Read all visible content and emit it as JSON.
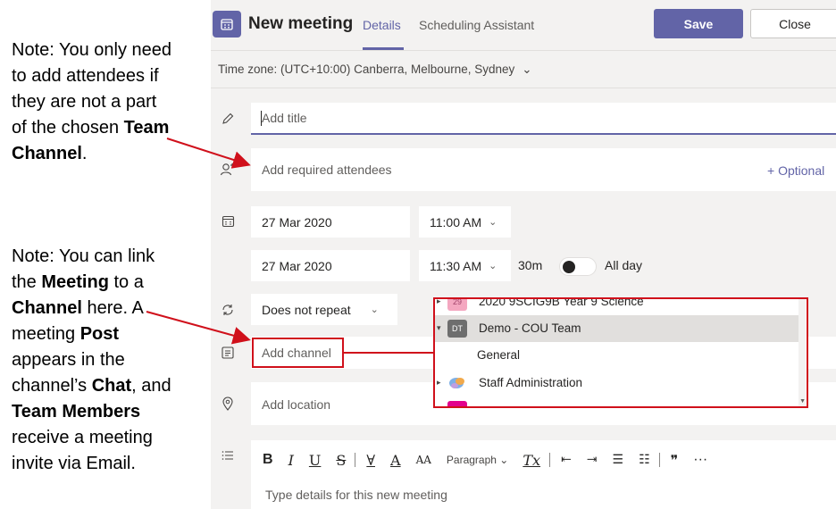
{
  "annotations": {
    "note1": {
      "p1": "Note: You only need to add attendees if they are not a part of the chosen ",
      "b1": "Team Channel",
      "p2": "."
    },
    "note2": {
      "p1": "Note: You can link the ",
      "b1": "Meeting",
      "p2": " to a ",
      "b2": "Channel",
      "p3": " here. A meeting ",
      "b3": "Post",
      "p4": " appears in the channel’s ",
      "b4": "Chat",
      "p5": ", and ",
      "b5": "Team Members",
      "p6": " receive a meeting invite via Email."
    },
    "highlight_color": "#d0101b"
  },
  "header": {
    "title": "New meeting",
    "tabs": [
      "Details",
      "Scheduling Assistant"
    ],
    "save_label": "Save",
    "close_label": "Close",
    "accent": "#6264a7"
  },
  "timezone": {
    "label": "Time zone: (UTC+10:00) Canberra, Melbourne, Sydney",
    "chevron": "⌄"
  },
  "form": {
    "title_placeholder": "Add title",
    "attendees_placeholder": "Add required attendees",
    "optional_label": "+ Optional",
    "start_date": "27 Mar 2020",
    "start_time": "11:00 AM",
    "end_date": "27 Mar 2020",
    "end_time": "11:30 AM",
    "duration": "30m",
    "all_day_label": "All day",
    "all_day_on": false,
    "repeat": "Does not repeat",
    "channel_placeholder": "Add channel",
    "location_placeholder": "Add location",
    "details_placeholder": "Type details for this new meeting",
    "chevron": "⌄"
  },
  "toolbar": {
    "bold": "B",
    "italic": "I",
    "underline": "U",
    "strike": "S",
    "highlight": "∀",
    "font_color": "A",
    "font_size": "AA",
    "paragraph": "Paragraph ⌄",
    "clear_format": "Tx",
    "outdent": "⇤",
    "indent": "⇥",
    "bullets": "☰",
    "numbered": "☷",
    "quote": "❞",
    "more": "···"
  },
  "channel_dropdown": {
    "items": [
      {
        "label": "2020 9SCIG9B Year 9 Science",
        "arrow": "▸",
        "avatar": "29",
        "avatar_color": "#f4a7c0",
        "level": 0,
        "selected": false
      },
      {
        "label": "Demo - COU Team",
        "arrow": "▾",
        "avatar": "DT",
        "avatar_color": "#6e6e6e",
        "level": 0,
        "selected": true
      },
      {
        "label": "General",
        "arrow": "",
        "avatar": "",
        "avatar_color": "",
        "level": 1,
        "selected": false
      },
      {
        "label": "Staff Administration",
        "arrow": "▸",
        "avatar": "",
        "avatar_color": "#7fb0e5",
        "level": 0,
        "selected": false
      },
      {
        "label": "",
        "arrow": "",
        "avatar": "",
        "avatar_color": "#e3008c",
        "level": 0,
        "selected": false
      }
    ],
    "scroll_arrow": "▼"
  }
}
